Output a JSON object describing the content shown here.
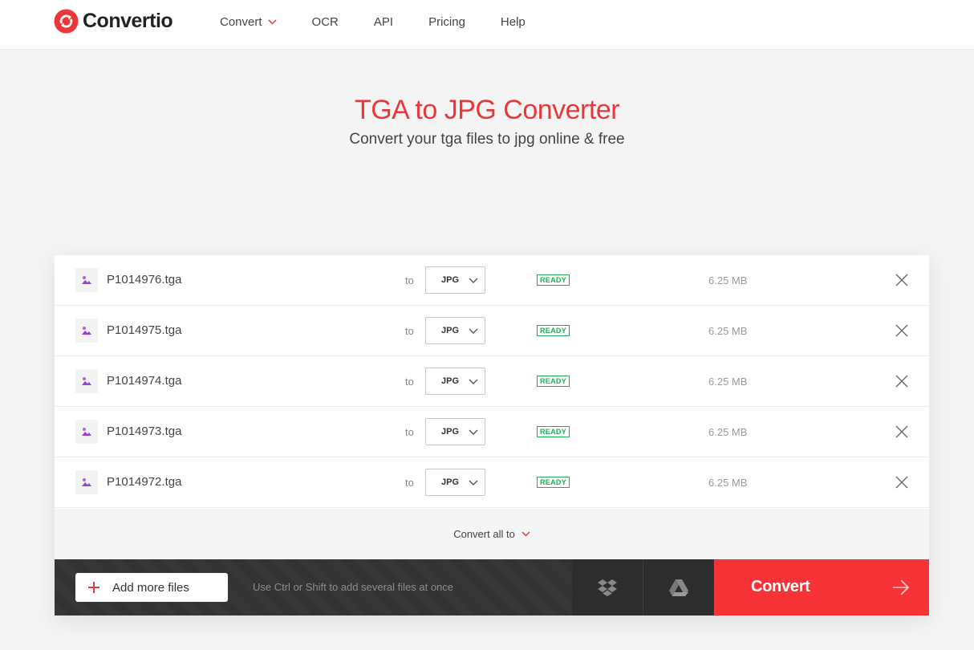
{
  "brand": {
    "name": "Convertio",
    "accent": "#e8383a"
  },
  "nav": {
    "items": [
      {
        "label": "Convert",
        "has_dropdown": true
      },
      {
        "label": "OCR"
      },
      {
        "label": "API"
      },
      {
        "label": "Pricing"
      },
      {
        "label": "Help"
      }
    ]
  },
  "hero": {
    "title": "TGA to JPG Converter",
    "subtitle": "Convert your tga files to jpg online & free"
  },
  "files": {
    "to_label": "to",
    "items": [
      {
        "name": "P1014976.tga",
        "format": "JPG",
        "status": "READY",
        "size": "6.25 MB"
      },
      {
        "name": "P1014975.tga",
        "format": "JPG",
        "status": "READY",
        "size": "6.25 MB"
      },
      {
        "name": "P1014974.tga",
        "format": "JPG",
        "status": "READY",
        "size": "6.25 MB"
      },
      {
        "name": "P1014973.tga",
        "format": "JPG",
        "status": "READY",
        "size": "6.25 MB"
      },
      {
        "name": "P1014972.tga",
        "format": "JPG",
        "status": "READY",
        "size": "6.25 MB"
      }
    ]
  },
  "convert_all": {
    "label": "Convert all to"
  },
  "bottom_bar": {
    "add_label": "Add more files",
    "hint": "Use Ctrl or Shift to add several files at once",
    "dropbox_icon": "dropbox-icon",
    "gdrive_icon": "google-drive-icon",
    "convert_label": "Convert",
    "convert_color": "#f83337",
    "status_color": "#20ad56"
  }
}
